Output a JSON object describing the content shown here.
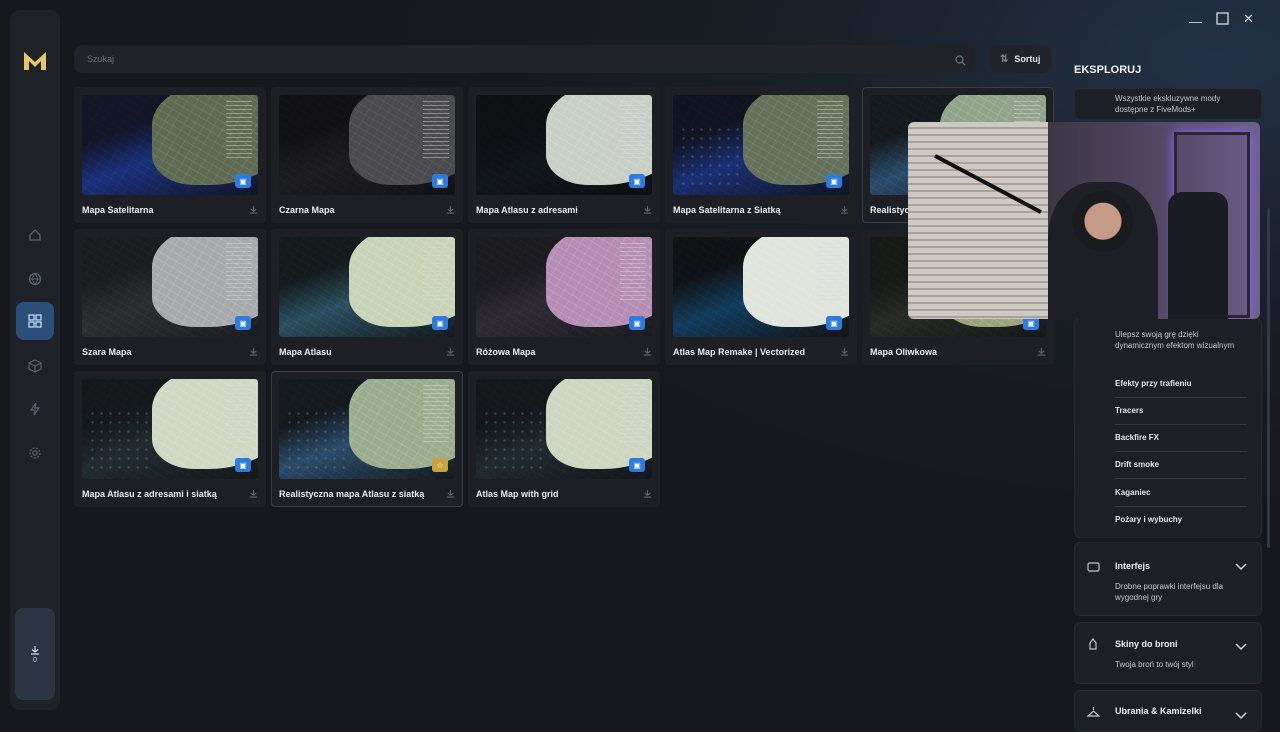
{
  "window": {
    "minimize_icon": "minimize-icon",
    "maximize_icon": "maximize-icon",
    "close_icon": "close-icon"
  },
  "sidebar": {
    "logo": "fivemods-logo",
    "items": [
      {
        "icon": "home-icon",
        "active": false
      },
      {
        "icon": "globe-icon",
        "active": false
      },
      {
        "icon": "grid-icon",
        "active": true
      },
      {
        "icon": "cube-icon",
        "active": false
      },
      {
        "icon": "bolt-icon",
        "active": false
      },
      {
        "icon": "gear-icon",
        "active": false
      }
    ],
    "downloads": {
      "icon": "download-icon",
      "count": "0"
    }
  },
  "search": {
    "placeholder": "Szukaj",
    "value": ""
  },
  "sort": {
    "label": "Sortuj"
  },
  "maps": [
    {
      "title": "Mapa Satelitarna",
      "style": "satellite",
      "badge": "blue"
    },
    {
      "title": "Czarna Mapa",
      "style": "black",
      "badge": "blue"
    },
    {
      "title": "Mapa Atlasu z adresami",
      "style": "atlas-dark",
      "badge": "blue"
    },
    {
      "title": "Mapa Satelitarna z Siatką",
      "style": "satellite-grid",
      "badge": "blue"
    },
    {
      "title": "Realistyc",
      "style": "realistic",
      "badge": "blue"
    },
    {
      "title": "Szara Mapa",
      "style": "gray",
      "badge": "blue"
    },
    {
      "title": "Mapa Atlasu",
      "style": "atlas",
      "badge": "blue"
    },
    {
      "title": "Różowa Mapa",
      "style": "pink",
      "badge": "blue"
    },
    {
      "title": "Atlas Map Remake | Vectorized",
      "style": "vectorized",
      "badge": "blue"
    },
    {
      "title": "Mapa Oliwkowa",
      "style": "olive",
      "badge": "blue"
    },
    {
      "title": "Mapa Atlasu z adresami i siatką",
      "style": "atlas-grid",
      "badge": "blue"
    },
    {
      "title": "Realistyczna mapa Atlasu z siatką",
      "style": "realistic-grid",
      "badge": "gold"
    },
    {
      "title": "Atlas Map with grid",
      "style": "atlas-grid2",
      "badge": "blue"
    }
  ],
  "explore": {
    "title": "EKSPLORUJ",
    "exclusive_desc": "Wszystkie ekskluzywne mody dostępne z FiveMods+",
    "effects": {
      "desc": "Ulepsz swoją grę dzięki dynamicznym efektom wizualnym",
      "items": [
        "Efekty przy trafieniu",
        "Tracers",
        "Backfire FX",
        "Drift smoke",
        "Kaganiec",
        "Pożary i wybuchy"
      ]
    },
    "sections": [
      {
        "title": "Interfejs",
        "desc": "Drobne poprawki interfejsu dla wygodnej gry",
        "icon": "monitor-icon"
      },
      {
        "title": "Skiny do broni",
        "desc": "Twoja broń to twój styl",
        "icon": "weapon-icon"
      },
      {
        "title": "Ubrania & Kamizelki",
        "desc": "",
        "icon": "clothing-icon"
      }
    ]
  },
  "colors": {
    "accent": "#2d7be0",
    "active_nav": "#2b4f79",
    "premium": "#c9a33f",
    "bg": "#15171c"
  }
}
